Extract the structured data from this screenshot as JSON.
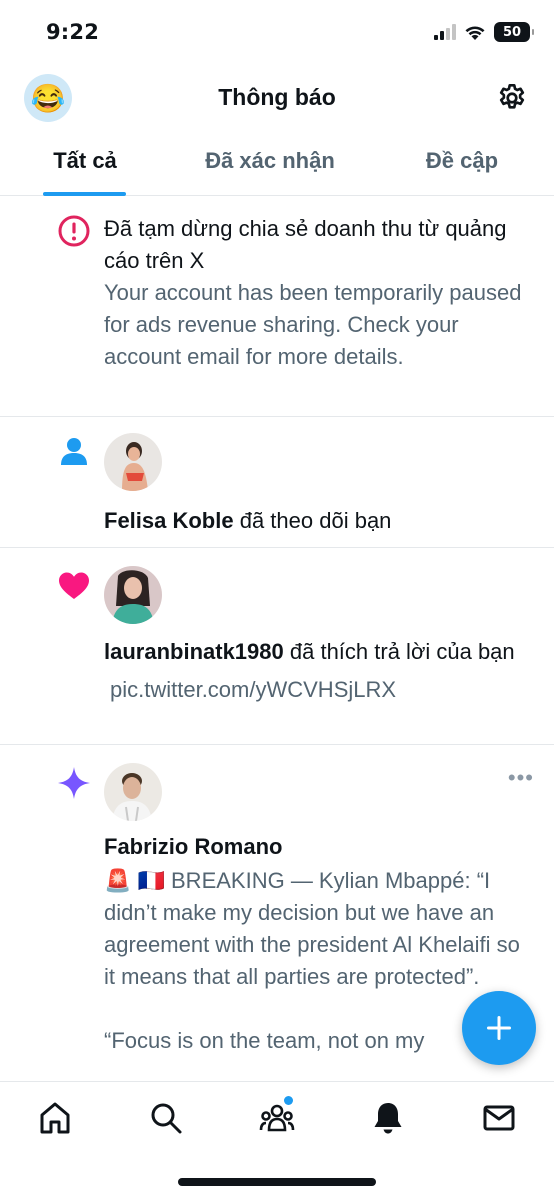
{
  "status_bar": {
    "time": "9:22",
    "battery": "50"
  },
  "header": {
    "title": "Thông báo",
    "avatar_emoji": "😂"
  },
  "tabs": [
    {
      "label": "Tất cả",
      "active": true
    },
    {
      "label": "Đã xác nhận",
      "active": false
    },
    {
      "label": "Đề cập",
      "active": false
    }
  ],
  "notifications": {
    "alert": {
      "title": "Đã tạm dừng chia sẻ doanh thu từ quảng cáo trên X",
      "body": "Your account has been temporarily paused for ads revenue sharing. Check your account email for more details."
    },
    "follow": {
      "user": "Felisa Koble",
      "action": "đã theo dõi bạn"
    },
    "like": {
      "user": "lauranbinatk1980",
      "action": "đã thích trả lời của bạn",
      "link": "pic.twitter.com/yWCVHSjLRX"
    },
    "post": {
      "user": "Fabrizio Romano",
      "more": "•••",
      "text_1": "🚨 🇫🇷 BREAKING — Kylian Mbappé: “I didn’t make my decision but we have an agreement with the president Al Khelaifi so it means that all parties are protected”.",
      "text_2": "“Focus is on the team, not on my"
    }
  },
  "colors": {
    "accent": "#1d9bf0",
    "alert_red": "#e0245e",
    "follow_blue": "#1d9bf0",
    "like_pink": "#f91880",
    "star_purple": "#7856ff",
    "muted_text": "#536471"
  },
  "icons": [
    "gear-icon",
    "alert-circle-icon",
    "person-icon",
    "heart-icon",
    "sparkle-icon",
    "plus-icon",
    "home-icon",
    "search-icon",
    "communities-icon",
    "bell-icon",
    "mail-icon"
  ]
}
